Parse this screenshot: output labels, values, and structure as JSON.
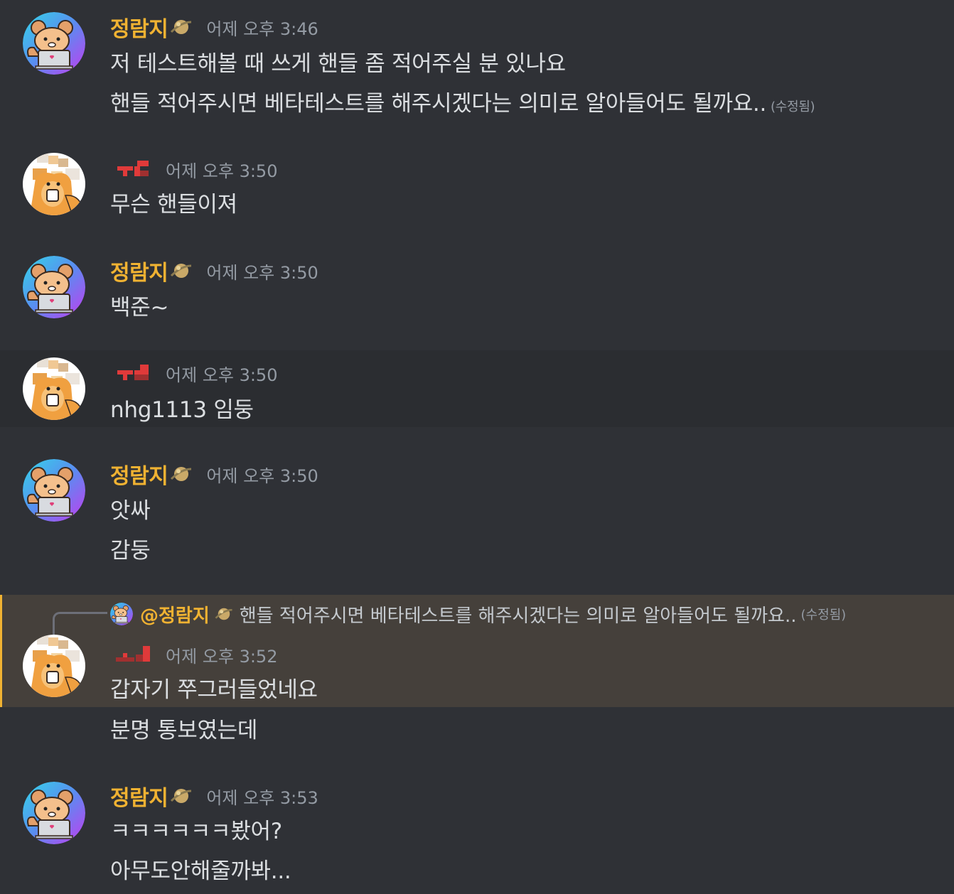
{
  "messages": [
    {
      "author": "정람지",
      "timestamp": "어제 오후 3:46",
      "lines": [
        "저 테스트해볼 때 쓰게 핸들 좀 적어주실 분 있나요",
        "핸들 적어주시면 베타테스트를 해주시겠다는 의미로 알아들어도 될까요.."
      ],
      "edited": "(수정됨)"
    },
    {
      "author": "",
      "timestamp": "어제 오후 3:50",
      "lines": [
        "무슨 핸들이져"
      ]
    },
    {
      "author": "정람지",
      "timestamp": "어제 오후 3:50",
      "lines": [
        "백준~"
      ]
    },
    {
      "author": "",
      "timestamp": "어제 오후 3:50",
      "lines": [
        "nhg1113 임둥"
      ]
    },
    {
      "author": "정람지",
      "timestamp": "어제 오후 3:50",
      "lines": [
        "앗싸",
        "감둥"
      ]
    },
    {
      "reply_to": {
        "mention": "@정람지",
        "text": "핸들 적어주시면 베타테스트를 해주시겠다는 의미로 알아들어도 될까요..",
        "edited": "(수정됨)"
      },
      "author": "",
      "timestamp": "어제 오후 3:52",
      "lines": [
        "갑자기 쭈그러들었네요",
        "분명 통보였는데"
      ]
    },
    {
      "author": "정람지",
      "timestamp": "어제 오후 3:53",
      "lines": [
        "ㅋㅋㅋㅋㅋㅋ봤어?",
        "아무도안해줄까봐..."
      ]
    }
  ],
  "colors": {
    "background": "#2f3136",
    "username_gold": "#f0b232",
    "mention_highlight": "#45403b",
    "timestamp": "#949ba4"
  }
}
